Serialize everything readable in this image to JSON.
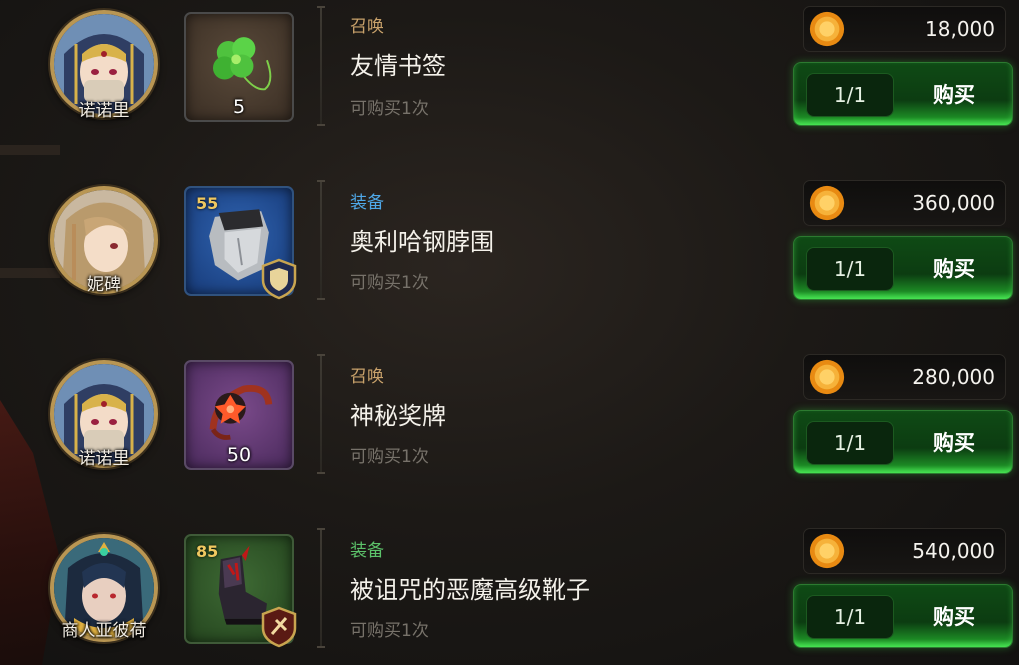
{
  "colors": {
    "category_summon": "#c9a26b",
    "category_equip": "#4fa8e8",
    "category_equip_green": "#5cc26a",
    "buy_button_green": "#1d8a25"
  },
  "items": [
    {
      "merchant": "诺诺里",
      "icon": "four-leaf-clover-icon",
      "count": "5",
      "level": "",
      "category": "召唤",
      "category_color": "#c9a26b",
      "title": "友情书签",
      "limit": "可购买1次",
      "price": "18,000",
      "qty": "1/1",
      "buy_label": "购买"
    },
    {
      "merchant": "妮碑",
      "icon": "steel-neckguard-icon",
      "count": "",
      "level": "55",
      "category": "装备",
      "category_color": "#4fa8e8",
      "title": "奥利哈钢脖围",
      "limit": "可购买1次",
      "price": "360,000",
      "qty": "1/1",
      "buy_label": "购买"
    },
    {
      "merchant": "诺诺里",
      "icon": "mystic-medal-icon",
      "count": "50",
      "level": "",
      "category": "召唤",
      "category_color": "#c9a26b",
      "title": "神秘奖牌",
      "limit": "可购买1次",
      "price": "280,000",
      "qty": "1/1",
      "buy_label": "购买"
    },
    {
      "merchant": "商人亚彼荷",
      "icon": "demon-boots-icon",
      "count": "",
      "level": "85",
      "category": "装备",
      "category_color": "#5cc26a",
      "title": "被诅咒的恶魔高级靴子",
      "limit": "可购买1次",
      "price": "540,000",
      "qty": "1/1",
      "buy_label": "购买"
    }
  ]
}
